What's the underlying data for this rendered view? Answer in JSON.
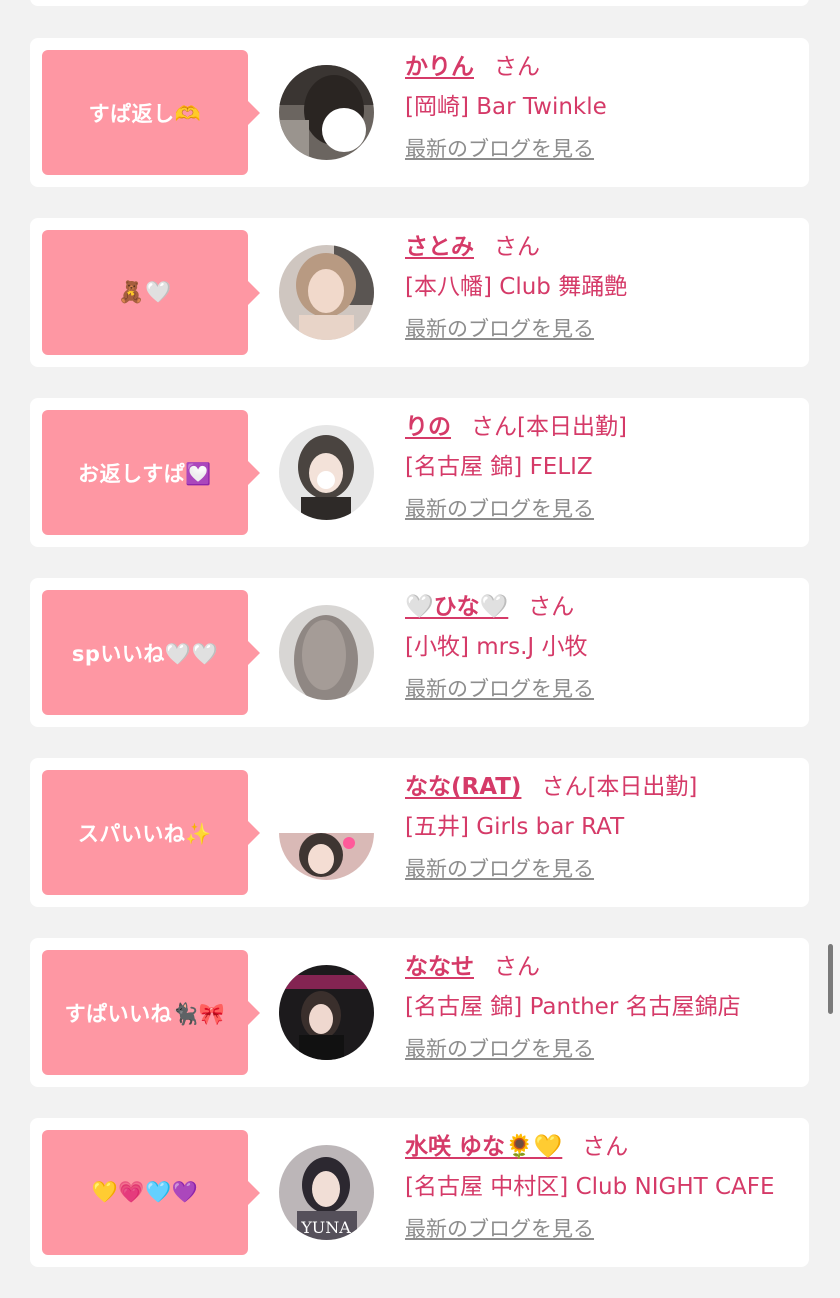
{
  "list": {
    "items": [
      {
        "comment": "すぱ返し🫶",
        "name": "かりん",
        "honorific": "さん",
        "status": "",
        "shop": "[岡崎] Bar Twinkle",
        "blog_link": "最新のブログを見る",
        "avatar": "avatar-photo-dark-hair"
      },
      {
        "comment": "🧸🤍",
        "name": "さとみ",
        "honorific": "さん",
        "status": "",
        "shop": "[本八幡] Club 舞踊艶",
        "blog_link": "最新のブログを見る",
        "avatar": "avatar-photo-light-hair"
      },
      {
        "comment": "お返しすぱ💟",
        "name": "りの",
        "honorific": "さん",
        "status": "[本日出勤]",
        "shop": "[名古屋 錦] FELIZ",
        "blog_link": "最新のブログを見る",
        "avatar": "avatar-photo-mono"
      },
      {
        "comment": "spいいね🤍🤍",
        "name": "🤍ひな🤍",
        "honorific": "さん",
        "status": "",
        "shop": "[小牧] mrs.J 小牧",
        "blog_link": "最新のブログを見る",
        "avatar": "avatar-photo-gray"
      },
      {
        "comment": "スパいいね✨",
        "name": "なな(RAT)",
        "honorific": "さん",
        "status": "[本日出勤]",
        "shop": "[五井] Girls bar RAT",
        "blog_link": "最新のブログを見る",
        "avatar": "avatar-photo-partial"
      },
      {
        "comment": "すぱいいね🐈‍⬛🎀",
        "name": "ななせ",
        "honorific": "さん",
        "status": "",
        "shop": "[名古屋 錦] Panther 名古屋錦店",
        "blog_link": "最新のブログを見る",
        "avatar": "avatar-photo-panther"
      },
      {
        "comment": "💛💗🩵💜",
        "name": "水咲 ゆな🌻💛",
        "honorific": "さん",
        "status": "",
        "shop": "[名古屋 中村区] Club NIGHT CAFE",
        "blog_link": "最新のブログを見る",
        "avatar": "avatar-photo-yuna",
        "avatar_text": "YUNA"
      }
    ]
  }
}
